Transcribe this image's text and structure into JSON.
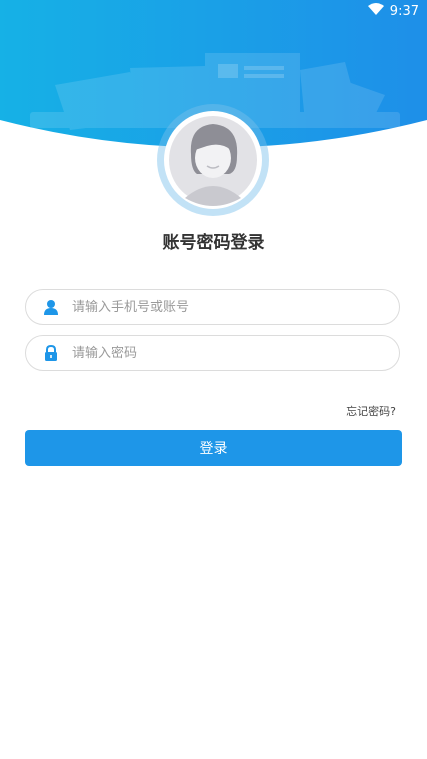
{
  "status": {
    "time": "9:37"
  },
  "header": {
    "bg_color": "#1ea0e6",
    "accent": "#1e96e8"
  },
  "title": "账号密码登录",
  "username": {
    "placeholder": "请输入手机号或账号",
    "value": ""
  },
  "password": {
    "placeholder": "请输入密码",
    "value": ""
  },
  "forgot_label": "忘记密码?",
  "login_label": "登录"
}
